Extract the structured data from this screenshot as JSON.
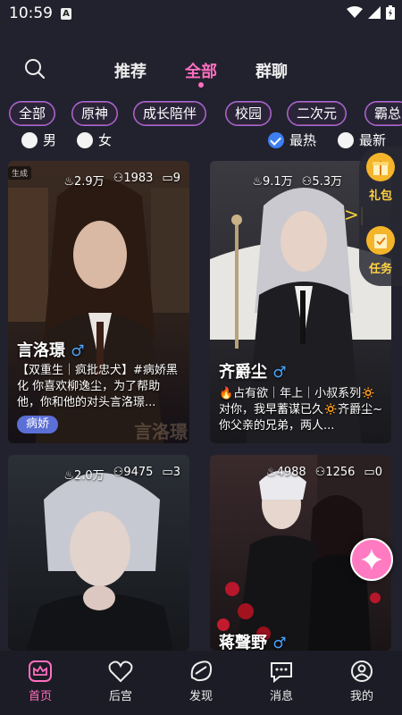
{
  "status": {
    "time": "10:59",
    "a_badge": "A"
  },
  "topnav": {
    "tabs": [
      "推荐",
      "全部",
      "群聊"
    ],
    "active_index": 1
  },
  "chips": [
    "全部",
    "原神",
    "成长陪伴",
    "校园",
    "二次元",
    "霸总"
  ],
  "filters": {
    "gender": [
      {
        "label": "男",
        "checked": false
      },
      {
        "label": "女",
        "checked": false
      }
    ],
    "sort": [
      {
        "label": "最热",
        "checked": true
      },
      {
        "label": "最新",
        "checked": false
      }
    ]
  },
  "side": {
    "gift_label": "礼包",
    "task_label": "任务"
  },
  "cards": [
    {
      "heat": "2.9万",
      "users": "1983",
      "comments": "9",
      "badge": "生成",
      "name": "言洛璟",
      "desc": "【双重生｜疯批忠犬】#病娇黑化 你喜欢柳逸尘，为了帮助他，你和他的对头言洛璟...",
      "tag": "病娇",
      "watermark": "言洛璟"
    },
    {
      "heat": "9.1万",
      "users": "5.3万",
      "comments": "",
      "name": "齐爵尘",
      "desc": "🔥占有欲｜年上｜小叔系列🔅对你，我早蓄谋已久🔅齐爵尘~你父亲的兄弟，两人..."
    },
    {
      "heat": "2.0万",
      "users": "9475",
      "comments": "3"
    },
    {
      "heat": "4988",
      "users": "1256",
      "comments": "0",
      "name": "蒋聲野"
    }
  ],
  "bottom": [
    "首页",
    "后宫",
    "发现",
    "消息",
    "我的"
  ],
  "colors": {
    "accent": "#ff6fbf",
    "bg": "#22222e",
    "chip_border": "#a06ae8",
    "check": "#3c7ff2",
    "gold": "#ffd23f"
  }
}
